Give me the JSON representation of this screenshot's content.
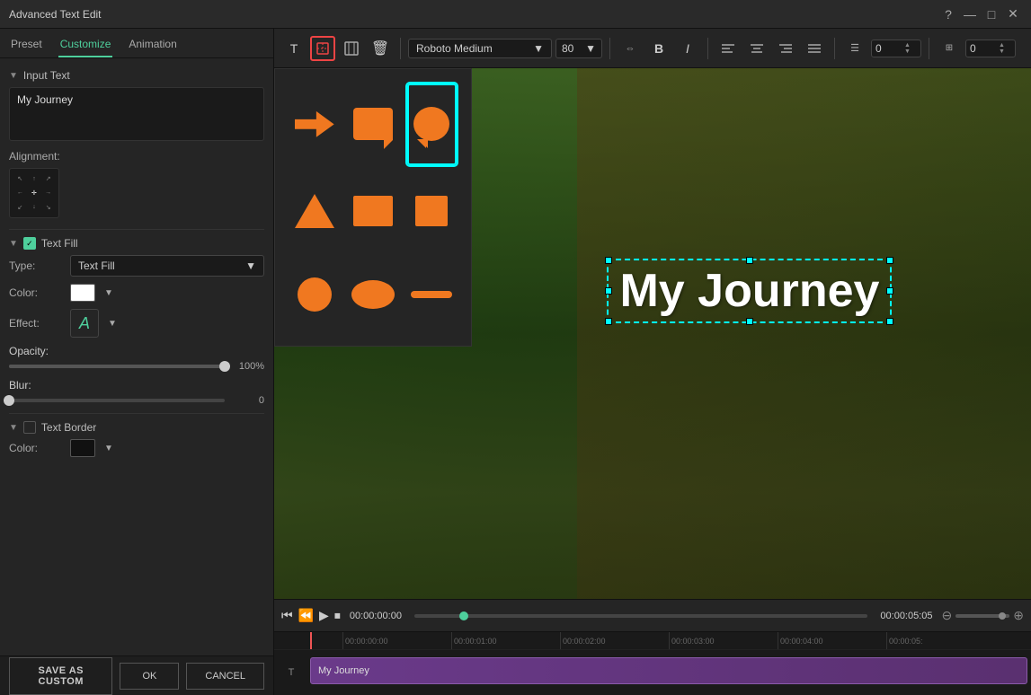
{
  "titlebar": {
    "title": "Advanced Text Edit",
    "help_icon": "?",
    "minimize_icon": "—",
    "maximize_icon": "□",
    "close_icon": "✕"
  },
  "tabs": {
    "preset": "Preset",
    "customize": "Customize",
    "animation": "Animation"
  },
  "left_panel": {
    "input_text_section": "Input Text",
    "input_text_value": "My Journey",
    "alignment_label": "Alignment:",
    "text_fill_section": "Text Fill",
    "type_label": "Type:",
    "type_value": "Text Fill",
    "color_label": "Color:",
    "effect_label": "Effect:",
    "opacity_label": "Opacity:",
    "opacity_value": "100%",
    "blur_label": "Blur:",
    "blur_value": "0",
    "text_border_section": "Text Border",
    "color_border_label": "Color:"
  },
  "toolbar": {
    "font_name": "Roboto Medium",
    "font_size": "80",
    "bold": "B",
    "italic": "I",
    "align_icons": [
      "align-left",
      "align-center",
      "align-right",
      "align-justify"
    ],
    "spacing_value": "0",
    "offset_value": "0"
  },
  "preview": {
    "text": "My Journey"
  },
  "playback": {
    "current_time": "00:00:00:00",
    "total_time": "00:00:05:05"
  },
  "timeline": {
    "ruler_marks": [
      "00:00:00:00",
      "00:00:01:00",
      "00:00:02:00",
      "00:00:03:00",
      "00:00:04:00",
      "00:00:05:"
    ],
    "clip_label": "My Journey"
  },
  "buttons": {
    "save_as_custom": "SAVE AS CUSTOM",
    "ok": "OK",
    "cancel": "CANCEL"
  }
}
